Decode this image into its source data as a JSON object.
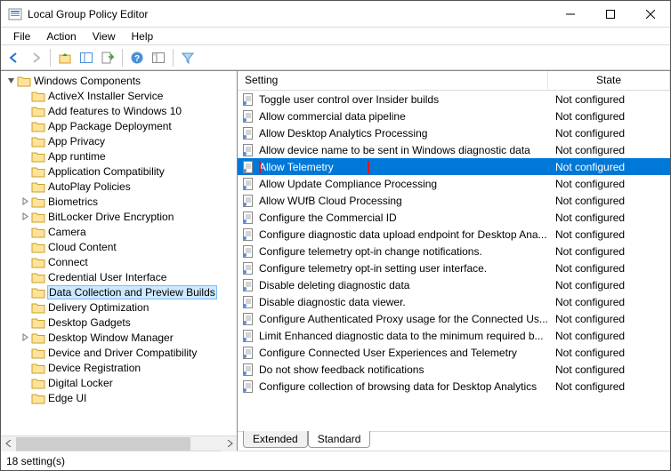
{
  "window": {
    "title": "Local Group Policy Editor"
  },
  "menu": {
    "file": "File",
    "action": "Action",
    "view": "View",
    "help": "Help"
  },
  "tree": {
    "root": "Windows Components",
    "items": [
      {
        "label": "ActiveX Installer Service",
        "expandable": false
      },
      {
        "label": "Add features to Windows 10",
        "expandable": false
      },
      {
        "label": "App Package Deployment",
        "expandable": false
      },
      {
        "label": "App Privacy",
        "expandable": false
      },
      {
        "label": "App runtime",
        "expandable": false
      },
      {
        "label": "Application Compatibility",
        "expandable": false
      },
      {
        "label": "AutoPlay Policies",
        "expandable": false
      },
      {
        "label": "Biometrics",
        "expandable": true
      },
      {
        "label": "BitLocker Drive Encryption",
        "expandable": true
      },
      {
        "label": "Camera",
        "expandable": false
      },
      {
        "label": "Cloud Content",
        "expandable": false
      },
      {
        "label": "Connect",
        "expandable": false
      },
      {
        "label": "Credential User Interface",
        "expandable": false
      },
      {
        "label": "Data Collection and Preview Builds",
        "expandable": false,
        "selected": true
      },
      {
        "label": "Delivery Optimization",
        "expandable": false
      },
      {
        "label": "Desktop Gadgets",
        "expandable": false
      },
      {
        "label": "Desktop Window Manager",
        "expandable": true
      },
      {
        "label": "Device and Driver Compatibility",
        "expandable": false
      },
      {
        "label": "Device Registration",
        "expandable": false
      },
      {
        "label": "Digital Locker",
        "expandable": false
      },
      {
        "label": "Edge UI",
        "expandable": false
      }
    ]
  },
  "list": {
    "col_setting": "Setting",
    "col_state": "State",
    "rows": [
      {
        "label": "Toggle user control over Insider builds",
        "state": "Not configured"
      },
      {
        "label": "Allow commercial data pipeline",
        "state": "Not configured"
      },
      {
        "label": "Allow Desktop Analytics Processing",
        "state": "Not configured"
      },
      {
        "label": "Allow device name to be sent in Windows diagnostic data",
        "state": "Not configured"
      },
      {
        "label": "Allow Telemetry",
        "state": "Not configured",
        "selected": true,
        "highlight": true
      },
      {
        "label": "Allow Update Compliance Processing",
        "state": "Not configured"
      },
      {
        "label": "Allow WUfB Cloud Processing",
        "state": "Not configured"
      },
      {
        "label": "Configure the Commercial ID",
        "state": "Not configured"
      },
      {
        "label": "Configure diagnostic data upload endpoint for Desktop Ana...",
        "state": "Not configured"
      },
      {
        "label": "Configure telemetry opt-in change notifications.",
        "state": "Not configured"
      },
      {
        "label": "Configure telemetry opt-in setting user interface.",
        "state": "Not configured"
      },
      {
        "label": "Disable deleting diagnostic data",
        "state": "Not configured"
      },
      {
        "label": "Disable diagnostic data viewer.",
        "state": "Not configured"
      },
      {
        "label": "Configure Authenticated Proxy usage for the Connected Us...",
        "state": "Not configured"
      },
      {
        "label": "Limit Enhanced diagnostic data to the minimum required b...",
        "state": "Not configured"
      },
      {
        "label": "Configure Connected User Experiences and Telemetry",
        "state": "Not configured"
      },
      {
        "label": "Do not show feedback notifications",
        "state": "Not configured"
      },
      {
        "label": "Configure collection of browsing data for Desktop Analytics",
        "state": "Not configured"
      }
    ]
  },
  "tabs": {
    "extended": "Extended",
    "standard": "Standard"
  },
  "status": {
    "text": "18 setting(s)"
  }
}
